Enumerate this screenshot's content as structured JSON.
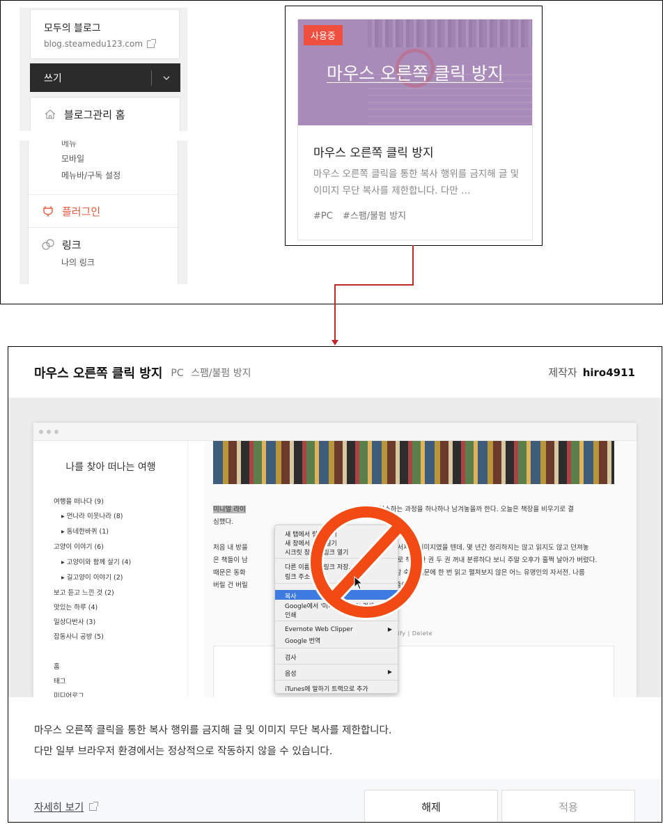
{
  "top": {
    "blog": {
      "name": "모두의 블로그",
      "url": "blog.steamedu123.com"
    },
    "write_label": "쓰기",
    "home_label": "블로그관리 홈",
    "menu": {
      "cut_item": "메뉴",
      "items": [
        "모바일",
        "메뉴바/구독 설정"
      ],
      "plugin_label": "플러그인",
      "link_label": "링크",
      "link_items": [
        "나의 링크"
      ]
    },
    "card": {
      "badge": "사용중",
      "thumb_title": "마우스 오른쪽 클릭 방지",
      "title": "마우스 오른쪽 클릭 방지",
      "desc": "마우스 오른쪽 클릭을 통한 복사 행위를 금지해 글 및 이미지 무단 복사를 제한합니다. 다만 …",
      "tags": [
        "#PC",
        "#스팸/불펌 방지"
      ]
    }
  },
  "modal": {
    "title": "마우스 오른쪽 클릭 방지",
    "tags": [
      "PC",
      "스팸/불펌 방지"
    ],
    "maker_label": "제작자",
    "maker_name": "hiro4911",
    "preview": {
      "blog_title": "나를 찾아 떠나는 여행",
      "categories": [
        "여행을 떠나다 (9)",
        "▸ 먼나라 이웃나라 (8)",
        "▸ 동네한바퀴 (1)",
        "고양이 이야기 (6)",
        "▸ 고양이와 함께 살기 (4)",
        "▸ 길고양이 이야기 (2)",
        "보고 듣고 느낀 것 (2)",
        "맛있는 하루 (4)",
        "일상다반사 (3)",
        "잡동사니 공방 (5)",
        "홈",
        "태그",
        "미디어로그"
      ],
      "para1_highlight": "미니멀 라이",
      "para1_line1": "고자 청소하는 과정을 하나하나 남겨놓을까 한다. 오늘은 책장을 비우기로 결",
      "para1_line2": "심했다.",
      "para2_lines": [
        "처음 내 방을",
        "은 책들이 남",
        "때문은 동화",
        "버릴 건 버릴"
      ],
      "para2_right": [
        "인 오  서재의 이미지였을 텐데. 몇 년간 정리하지는 않고 읽지도 않고 던져놓",
        "는 기    로 책을 한 권 두 권 꺼내 분류하다 보니 주말 오후가 훌쩍 날아가 버렸다.",
        "집    후감 숙제 때문에 한 번 읽고 펼쳐보지 않은 어느 유명인의 자서전. 나름",
        "       많을 줄이야."
      ],
      "actions": "Modify  |  Delete",
      "context_menu": [
        "새 탭에서 링크 열기",
        "새 창에서 링크 열기",
        "시크릿 창에서 링크 열기",
        "다른 이름으로 링크 저장...",
        "링크 주소 복사",
        "복사",
        "Google에서 '미니멀 라이프' 검색",
        "인쇄",
        "Evernote Web Clipper",
        "Google 번역",
        "검사",
        "음성",
        "iTunes에 말하기 트랙으로 추가"
      ]
    },
    "desc_lines": [
      "마우스 오른쪽 클릭을 통한 복사 행위를 금지해 글 및 이미지 무단 복사를 제한합니다.",
      "다만 일부 브라우저 환경에서는 정상적으로 작동하지 않을 수 있습니다."
    ],
    "more_link": "자세히 보기",
    "release_button": "해제",
    "apply_button": "적용"
  },
  "colors": {
    "accent": "#ef4f3f",
    "connector": "#c0282a",
    "dark": "#2b2b2b",
    "thumb": "#a98bb9"
  },
  "icons": [
    "external-link-icon",
    "chevron-down-icon",
    "home-icon",
    "plugin-icon",
    "link-icon",
    "ban-icon",
    "cursor-icon"
  ]
}
